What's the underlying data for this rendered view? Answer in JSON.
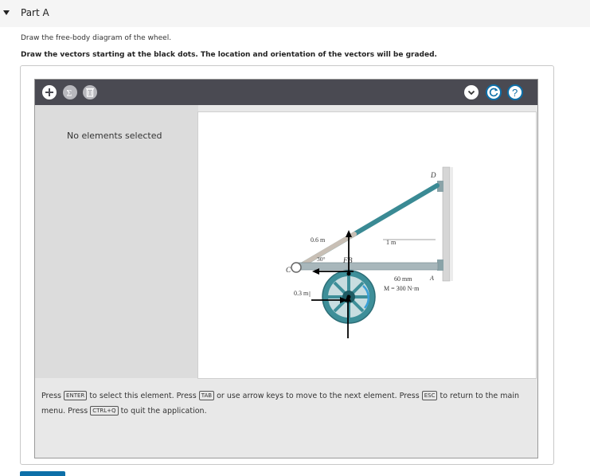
{
  "part": {
    "title": "Part A"
  },
  "instructions": {
    "line1": "Draw the free-body diagram of the wheel.",
    "line2": "Draw the vectors starting at the black dots. The location and orientation of the vectors will be graded."
  },
  "toolbar": {
    "icons": [
      "plus-icon",
      "sigma-icon",
      "trash-icon",
      "chevron-down-icon",
      "reset-icon",
      "help-icon"
    ],
    "help_label": "?",
    "sigma_label": "Σ"
  },
  "left_panel": {
    "status": "No elements selected"
  },
  "figure": {
    "label_D": "D",
    "label_C": "C",
    "label_A": "A",
    "label_B": "B",
    "label_F": "F",
    "dim_06": "0.6 m",
    "dim_30": "30°",
    "dim_1m": "1 m",
    "dim_03": "0.3 m",
    "dim_60mm": "60 mm",
    "moment": "M = 300 N·m"
  },
  "help": {
    "press1": "Press",
    "key_enter": "ENTER",
    "text1": "to select this element. Press",
    "key_tab": "TAB",
    "text2": "or use arrow keys to move to the next element. Press",
    "key_esc": "ESC",
    "text3": "to return to the main menu. Press",
    "key_ctrlq": "CTRL+Q",
    "text4": "to quit the application."
  },
  "colors": {
    "toolbar_bg": "#4a4a52",
    "accent": "#0d6fa8",
    "member": "#3a8a94"
  }
}
